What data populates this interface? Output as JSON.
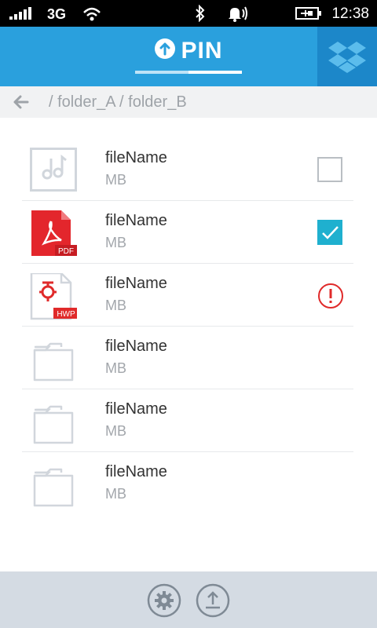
{
  "status_bar": {
    "network": "3G",
    "time": "12:38",
    "icons": [
      "signal-icon",
      "wifi-icon",
      "bluetooth-icon",
      "ringer-icon",
      "battery-charging-icon"
    ]
  },
  "header": {
    "title": "PIN",
    "title_icon": "pin-upload-icon",
    "right_button_icon": "dropbox-icon",
    "colors": {
      "header": "#2aa0dd",
      "dropbox_button": "#1c87c9"
    }
  },
  "breadcrumb": {
    "back_icon": "back-arrow-icon",
    "path": "/ folder_A / folder_B"
  },
  "files": [
    {
      "name": "fileName",
      "size": "MB",
      "type": "music",
      "status": "unchecked"
    },
    {
      "name": "fileName",
      "size": "MB",
      "type": "pdf",
      "badge": "PDF",
      "status": "checked"
    },
    {
      "name": "fileName",
      "size": "MB",
      "type": "hwp",
      "badge": "HWP",
      "status": "error"
    },
    {
      "name": "fileName",
      "size": "MB",
      "type": "folder",
      "status": "none"
    },
    {
      "name": "fileName",
      "size": "MB",
      "type": "folder",
      "status": "none"
    },
    {
      "name": "fileName",
      "size": "MB",
      "type": "folder",
      "status": "none"
    }
  ],
  "bottom_bar": {
    "buttons": [
      {
        "name": "settings",
        "icon": "gear-icon"
      },
      {
        "name": "upload",
        "icon": "upload-icon"
      }
    ]
  },
  "colors": {
    "accent": "#1fb0cf",
    "error": "#e02a2a",
    "pdf_red": "#e3262c"
  }
}
